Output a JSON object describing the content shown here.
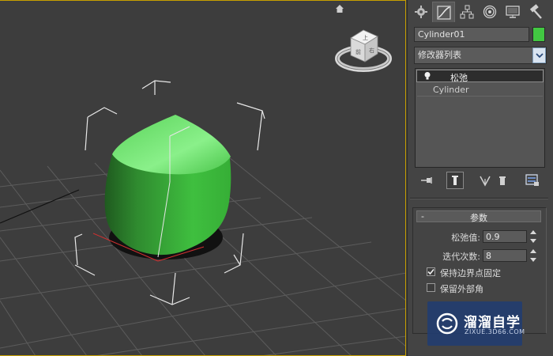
{
  "viewport": {
    "viewcube_faces": {
      "top": "上",
      "front": "前",
      "right": "右"
    }
  },
  "panel": {
    "tabs": [
      {
        "name": "create-tab",
        "icon": "sun-gear-icon"
      },
      {
        "name": "modify-tab",
        "icon": "modify-curve-icon"
      },
      {
        "name": "hierarchy-tab",
        "icon": "hierarchy-icon"
      },
      {
        "name": "motion-tab",
        "icon": "motion-circle-icon"
      },
      {
        "name": "display-tab",
        "icon": "monitor-icon"
      },
      {
        "name": "utilities-tab",
        "icon": "hammer-icon"
      }
    ],
    "object_name": "Cylinder01",
    "object_color": "#42c842",
    "modifier_list": "修改器列表",
    "stack": {
      "selected": "松弛",
      "base": "Cylinder"
    },
    "rollout": {
      "collapse": "-",
      "title": "参数",
      "relax_value_label": "松弛值:",
      "relax_value": "0.9",
      "iterations_label": "迭代次数:",
      "iterations": "8",
      "keep_boundary_label": "保持边界点固定",
      "keep_boundary_checked": true,
      "save_outer_label": "保留外部角",
      "save_outer_checked": false
    }
  },
  "watermark": {
    "title": "溜溜自学",
    "url": "ZIXUE.3D66.COM"
  }
}
